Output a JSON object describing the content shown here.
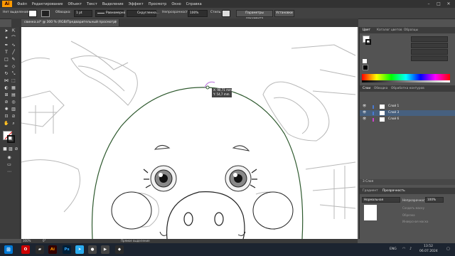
{
  "app": {
    "logo": "Ai"
  },
  "menu": [
    "Файл",
    "Редактирование",
    "Объект",
    "Текст",
    "Выделение",
    "Эффект",
    "Просмотр",
    "Окно",
    "Справка"
  ],
  "window_controls": {
    "minimize": "–",
    "maximize": "□",
    "close": "✕"
  },
  "control_bar": {
    "selection_label": "Нет выделения",
    "stroke_label": "Обводка:",
    "stroke_value": "1 pt",
    "uniform_label": "Равномерно",
    "brush_label": "Скругленна...",
    "opacity_label": "Непрозрачность:",
    "opacity_value": "100%",
    "style_label": "Стиль:",
    "doc_settings": "Параметры документа",
    "preferences": "Установки"
  },
  "document_tab": {
    "title": "свинка.ai* @ 300 % (RGB/Предварительный просмотр)",
    "close": "×"
  },
  "tooltip": {
    "x": "X: 90,71 mm",
    "y": "Y: 54,7 mm"
  },
  "top_panel": {
    "tabs": [
      "Цвет",
      "Каталог цветов",
      "Образцы"
    ]
  },
  "layers_panel": {
    "tabs": [
      "Слои",
      "Обводка",
      "Обработка контуров"
    ],
    "layers": [
      {
        "name": "Слой 1",
        "color": "#4a7bd0"
      },
      {
        "name": "Слой 3",
        "color": "#4a7bd0",
        "selected": true
      },
      {
        "name": "Слой 6",
        "color": "#cc44cc"
      }
    ],
    "count": "3 Слоя"
  },
  "transparency_panel": {
    "tabs": [
      "Градиент",
      "Прозрачность"
    ],
    "blend_mode": "Нормальная",
    "opacity_label": "Непрозрачность:",
    "opacity_value": "100%",
    "make_mask": "Создать маску",
    "clip": "Обрезка",
    "invert": "Инверсная маска"
  },
  "status_bar": {
    "zoom": "300%",
    "angle": "0°",
    "tool": "Прямое выделение"
  },
  "taskbar": {
    "lang": "ENG",
    "time": "13:52",
    "date": "06.07.2024"
  },
  "colors": {
    "accent": "#4a7bd0",
    "menubar": "#323232",
    "panel": "#535353",
    "selection_path": "#2f5a2f"
  }
}
